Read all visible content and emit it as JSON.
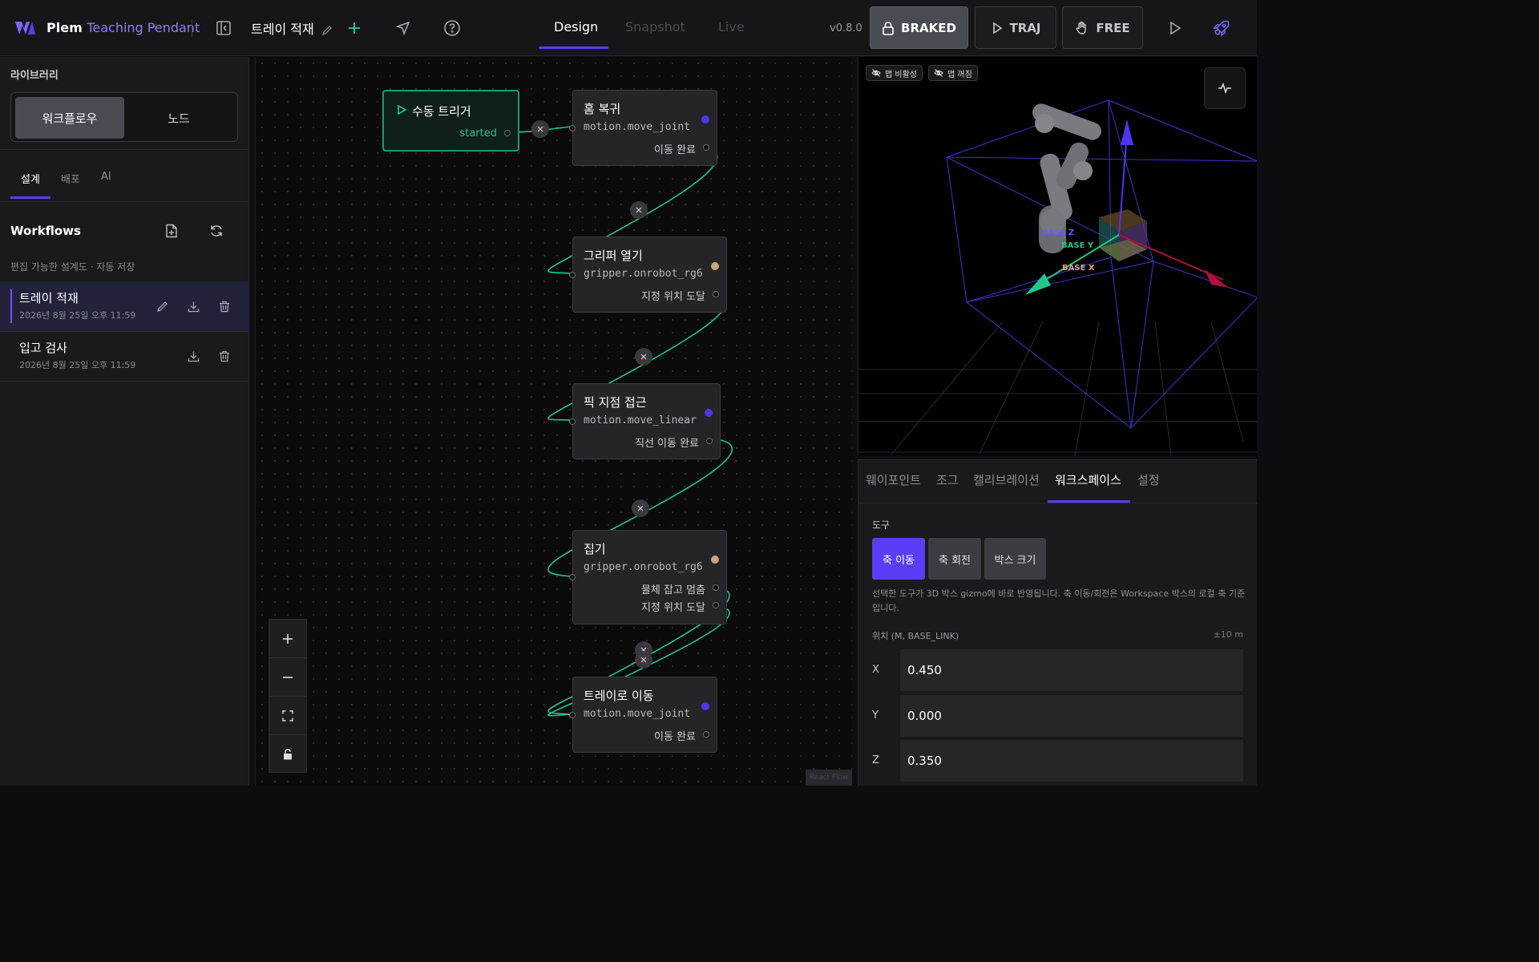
{
  "header": {
    "brand": "Plem",
    "brand_sub": "Teaching Pendant",
    "workflow_title": "트레이 적재",
    "tabs": [
      "Design",
      "Snapshot",
      "Live"
    ],
    "version": "v0.8.0",
    "modes": [
      "BRAKED",
      "TRAJ",
      "FREE"
    ]
  },
  "sidebar": {
    "library_label": "라이브러리",
    "segments": [
      "워크플로우",
      "노드"
    ],
    "sub_tabs": [
      "설계",
      "배포",
      "AI"
    ],
    "workflows_title": "Workflows",
    "workflows_desc": "편집 가능한 설계도 · 자동 저장",
    "workflows": [
      {
        "name": "트레이 적재",
        "date": "2026년 8월 25일 오후 11:59"
      },
      {
        "name": "입고 검사",
        "date": "2026년 8월 25일 오후 11:59"
      }
    ]
  },
  "canvas": {
    "trigger": {
      "title": "수동 트리거",
      "output": "started"
    },
    "nodes": [
      {
        "title": "홈 복귀",
        "type": "motion.move_joint",
        "outputs": [
          "이동 완료"
        ]
      },
      {
        "title": "그리퍼 열기",
        "type": "gripper.onrobot_rg6",
        "outputs": [
          "지정 위치 도달"
        ]
      },
      {
        "title": "픽 지점 접근",
        "type": "motion.move_linear",
        "outputs": [
          "직선 이동 완료"
        ]
      },
      {
        "title": "집기",
        "type": "gripper.onrobot_rg6",
        "outputs": [
          "물체 잡고 멈춤",
          "지정 위치 도달"
        ]
      },
      {
        "title": "트레이로 이동",
        "type": "motion.move_joint",
        "outputs": [
          "이동 완료"
        ]
      }
    ],
    "attribution": "React Flow",
    "colors": {
      "motion": "#4f35f0",
      "gripper": "#c9a47e",
      "edge": "#22c58a"
    }
  },
  "viewport": {
    "chips": [
      "맵 비활성",
      "맵 꺼짐"
    ],
    "axis_labels": [
      "BASE Z",
      "BASE Y",
      "BASE X"
    ]
  },
  "panel": {
    "tabs": [
      "웨이포인트",
      "조그",
      "캘리브레이션",
      "워크스페이스",
      "설정"
    ],
    "tool_label": "도구",
    "tools": [
      "축 이동",
      "축 회전",
      "박스 크기"
    ],
    "help": "선택한 도구가 3D 박스 gizmo에 바로 반영됩니다. 축 이동/회전은 Workspace 박스의 로컬 축 기준입니다.",
    "position_label": "위치 (M, BASE_LINK)",
    "position_range": "±10 m",
    "position": [
      {
        "axis": "X",
        "value": "0.450"
      },
      {
        "axis": "Y",
        "value": "0.000"
      },
      {
        "axis": "Z",
        "value": "0.350"
      }
    ]
  }
}
